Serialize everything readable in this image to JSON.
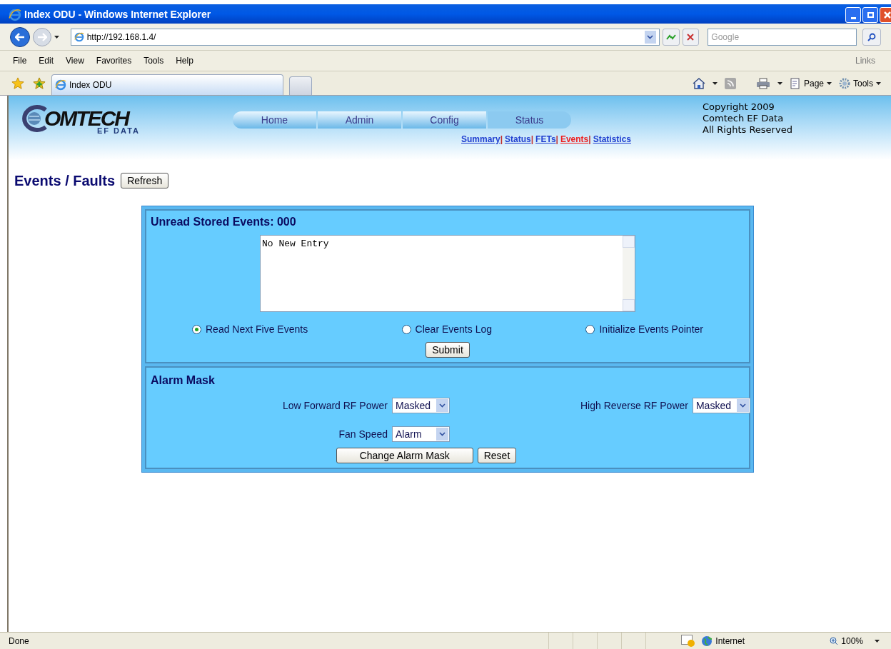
{
  "window": {
    "title": "Index ODU - Windows Internet Explorer"
  },
  "address_bar": {
    "url": "http://192.168.1.4/",
    "search_placeholder": "Google"
  },
  "menu": [
    "File",
    "Edit",
    "View",
    "Favorites",
    "Tools",
    "Help"
  ],
  "links_label": "Links",
  "tabs": [
    {
      "label": "Index ODU",
      "selected": true
    }
  ],
  "command_bar": [
    "Page",
    "Tools"
  ],
  "header": {
    "logo_text": "OMTECH",
    "logo_sub": "EF DATA",
    "copyright": [
      "Copyright 2009",
      "Comtech EF Data",
      "All Rights Reserved"
    ],
    "nav": [
      {
        "label": "Home",
        "selected": false
      },
      {
        "label": "Admin",
        "selected": false
      },
      {
        "label": "Config",
        "selected": false
      },
      {
        "label": "Status",
        "selected": true
      }
    ],
    "subnav": [
      {
        "label": "Summary",
        "selected": false
      },
      {
        "label": "Status",
        "selected": false
      },
      {
        "label": "FETs",
        "selected": false
      },
      {
        "label": "Events",
        "selected": true
      },
      {
        "label": "Statistics",
        "selected": false
      }
    ],
    "separator": "|"
  },
  "page_title": "Events / Faults",
  "refresh_button": "Refresh",
  "events_panel": {
    "title": "Unread Stored Events: 000",
    "log_text": "No New Entry",
    "options": [
      {
        "label": "Read Next Five Events",
        "selected": true
      },
      {
        "label": "Clear Events Log",
        "selected": false
      },
      {
        "label": "Initialize Events Pointer",
        "selected": false
      }
    ],
    "submit": "Submit"
  },
  "alarm_panel": {
    "title": "Alarm Mask",
    "fields": [
      {
        "label": "Low Forward RF Power",
        "value": "Masked"
      },
      {
        "label": "High Reverse RF Power",
        "value": "Masked"
      },
      {
        "label": "Fan Speed",
        "value": "Alarm"
      }
    ],
    "buttons": [
      "Change Alarm Mask",
      "Reset"
    ]
  },
  "status_bar": {
    "text": "Done",
    "zone": "Internet",
    "zoom": "100%"
  }
}
